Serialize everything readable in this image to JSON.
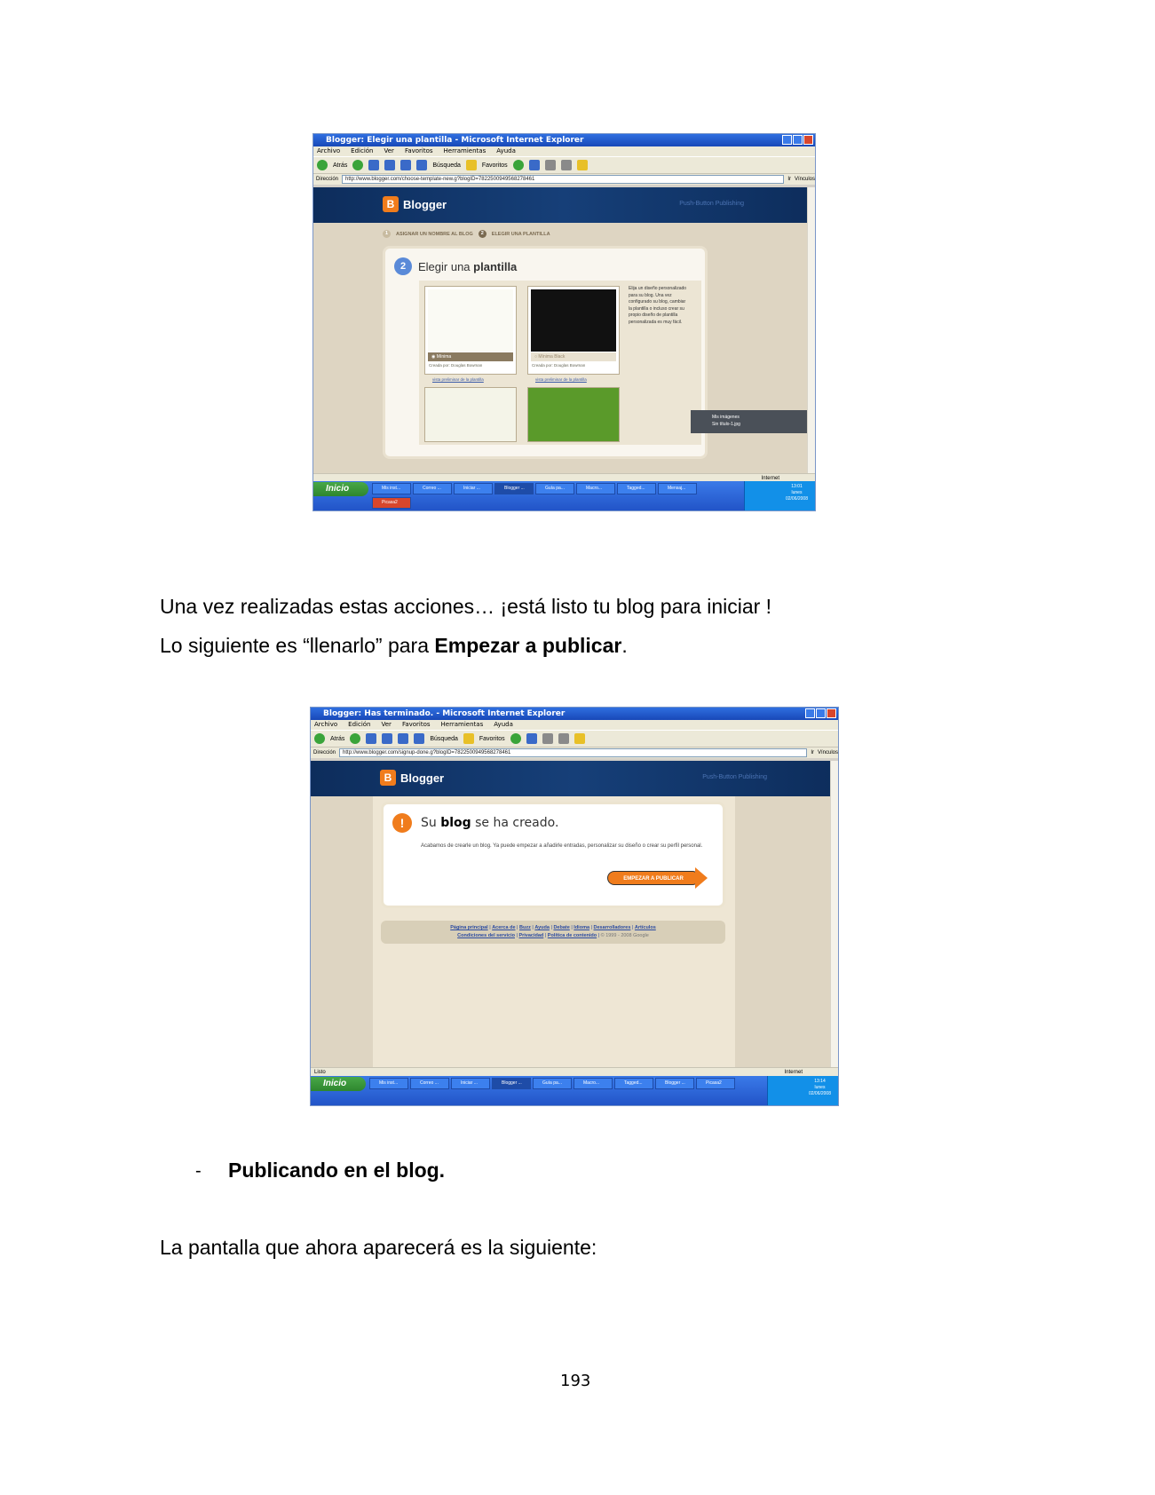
{
  "screenshot1": {
    "window_title": "Blogger: Elegir una plantilla - Microsoft Internet Explorer",
    "menu": [
      "Archivo",
      "Edición",
      "Ver",
      "Favoritos",
      "Herramientas",
      "Ayuda"
    ],
    "toolbar": {
      "back": "Atrás",
      "search": "Búsqueda",
      "favorites": "Favoritos"
    },
    "address_label": "Dirección",
    "url": "http://www.blogger.com/choose-template-new.g?blogID=7822500949568278461",
    "go_label": "Ir",
    "links_label": "Vínculos",
    "brand": "Blogger",
    "tagline": "Push-Button Publishing",
    "steps": [
      {
        "num": "1",
        "label": "ASIGNAR UN NOMBRE AL BLOG"
      },
      {
        "num": "2",
        "label": "ELEGIR UNA PLANTILLA"
      }
    ],
    "heading_num": "2",
    "heading_plain": "Elegir una",
    "heading_bold": "plantilla",
    "templates": [
      {
        "name": "Mínima",
        "credit": "Creada por: Douglas Bowman",
        "link": "vista preliminar de la plantilla"
      },
      {
        "name": "Mínima Black",
        "credit": "Creada por: Douglas Bowman",
        "link": "vista preliminar de la plantilla"
      }
    ],
    "note": "Elija un diseño personalizado para su blog. Una vez configurado su blog, cambiar la plantilla o incluso crear su propio diseño de plantilla personalizada es muy fácil.",
    "popup_title": "Mis imágenes",
    "popup_file": "Sin título-1.jpg",
    "status_zone": "Internet",
    "start_label": "Inicio",
    "tasks": [
      "Mis inst...",
      "Correo ...",
      "Iniciar ...",
      "Blogger ...",
      "Guía pa...",
      "Macro...",
      "Tagged...",
      "Mensaj...",
      "Picasa2"
    ],
    "clock": {
      "time": "13:01",
      "day": "lunes",
      "date": "02/06/2008"
    }
  },
  "text1_line1": "Una vez realizadas estas acciones… ¡está listo tu blog para iniciar !",
  "text1_line2_plain": "Lo siguiente  es “llenarlo” para  ",
  "text1_line2_bold": "Empezar a publicar",
  "text1_line2_end": ".",
  "screenshot2": {
    "window_title": "Blogger: Has terminado. - Microsoft Internet Explorer",
    "menu": [
      "Archivo",
      "Edición",
      "Ver",
      "Favoritos",
      "Herramientas",
      "Ayuda"
    ],
    "toolbar": {
      "back": "Atrás",
      "search": "Búsqueda",
      "favorites": "Favoritos"
    },
    "address_label": "Dirección",
    "url": "http://www.blogger.com/signup-done.g?blogID=7822500949568278461",
    "go_label": "Ir",
    "links_label": "Vínculos",
    "brand": "Blogger",
    "tagline": "Push-Button Publishing",
    "heading_plain_1": "Su ",
    "heading_bold": "blog",
    "heading_plain_2": " se ha creado.",
    "message": "Acabamos de crearle un blog. Ya puede empezar a añadirle entradas, personalizar su diseño o crear su perfil personal.",
    "button": "EMPEZAR A PUBLICAR",
    "footer_line1": [
      "Página principal",
      "Acerca de",
      "Buzz",
      "Ayuda",
      "Debate",
      "Idioma",
      "Desarrolladores",
      "Artículos"
    ],
    "footer_line2": [
      "Condiciones del servicio",
      "Privacidad",
      "Política de contenido"
    ],
    "copyright": "© 1999 - 2008 Google",
    "status_left": "Listo",
    "status_zone": "Internet",
    "start_label": "Inicio",
    "tasks": [
      "Mis inst...",
      "Correo ...",
      "Iniciar ...",
      "Blogger ...",
      "Guía pa...",
      "Macro...",
      "Tagged...",
      "Blogger ...",
      "Picasa2"
    ],
    "clock": {
      "time": "13:14",
      "day": "lunes",
      "date": "02/06/2008"
    }
  },
  "bullet_dash": "-",
  "bullet_text": "Publicando en el blog.",
  "text2": "La pantalla que ahora aparecerá es la siguiente:",
  "page_number": "193"
}
